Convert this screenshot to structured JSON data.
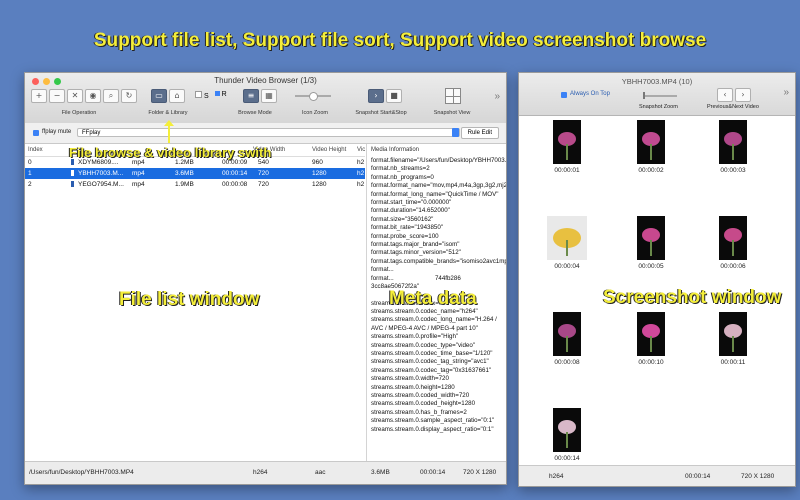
{
  "headline": "Support file list, Support file sort, Support video screenshot browse",
  "main_window": {
    "title": "Thunder Video Browser  (1/3)",
    "toolbar": {
      "file_operation_label": "File Operation",
      "folder_library_label": "Folder & Library",
      "browse_mode_label": "Browse Mode",
      "icon_zoom_label": "Icon Zoom",
      "snapshot_startstop_label": "Snapshot  Start&Stop",
      "snapshot_view_label": "Snapshot View",
      "s_toggle": "S",
      "r_toggle": "R"
    },
    "filter": {
      "checkbox_label": "ffplay mute",
      "player_value": "FFplay",
      "rule_edit_label": "Rule Edit"
    },
    "table": {
      "headers": [
        "Index",
        "",
        "",
        "",
        "Video Width",
        "Video Height",
        "Vic"
      ],
      "rows": [
        {
          "index": "0",
          "name": "XDYM6809....",
          "type": "mp4",
          "size": "1.2MB",
          "duration": "00:00:09",
          "width": "540",
          "height": "960",
          "codec": "h2"
        },
        {
          "index": "1",
          "name": "YBHH7003.M...",
          "type": "mp4",
          "size": "3.6MB",
          "duration": "00:00:14",
          "width": "720",
          "height": "1280",
          "codec": "h2"
        },
        {
          "index": "2",
          "name": "YEGO7954.M...",
          "type": "mp4",
          "size": "1.9MB",
          "duration": "00:00:08",
          "width": "720",
          "height": "1280",
          "codec": "h2"
        }
      ]
    },
    "meta": {
      "header": "Media Information",
      "lines": [
        "format.filename=\"/Users/fun/Desktop/YBHH7003.MP4\"",
        "format.nb_streams=2",
        "format.nb_programs=0",
        "format.format_name=\"mov,mp4,m4a,3gp,3g2,mj2\"",
        "format.format_long_name=\"QuickTime / MOV\"",
        "format.start_time=\"0.000000\"",
        "format.duration=\"14.652000\"",
        "format.size=\"3560162\"",
        "format.bit_rate=\"1943850\"",
        "format.probe_score=100",
        "format.tags.major_brand=\"isom\"",
        "format.tags.minor_version=\"512\"",
        "format.tags.compatible_brands=\"isomiso2avc1mp41\"",
        "format...",
        "format...                        744fb286",
        "3cc8ae50672f2a\"",
        "",
        "streams.stream.0.index=0",
        "streams.stream.0.codec_name=\"h264\"",
        "streams.stream.0.codec_long_name=\"H.264 / AVC / MPEG-4 AVC / MPEG-4 part 10\"",
        "streams.stream.0.profile=\"High\"",
        "streams.stream.0.codec_type=\"video\"",
        "streams.stream.0.codec_time_base=\"1/120\"",
        "streams.stream.0.codec_tag_string=\"avc1\"",
        "streams.stream.0.codec_tag=\"0x31637661\"",
        "streams.stream.0.width=720",
        "streams.stream.0.height=1280",
        "streams.stream.0.coded_width=720",
        "streams.stream.0.coded_height=1280",
        "streams.stream.0.has_b_frames=2",
        "streams.stream.0.sample_aspect_ratio=\"0:1\"",
        "streams.stream.0.display_aspect_ratio=\"0:1\""
      ]
    },
    "status": {
      "path": "/Users/fun/Desktop/YBHH7003.MP4",
      "video_codec": "h264",
      "audio_codec": "aac",
      "size": "3.6MB",
      "duration": "00:00:14",
      "resolution": "720 X 1280"
    }
  },
  "overlays": {
    "file_browse": "File browse & video library swith",
    "file_list": "File list window",
    "meta_data": "Meta data",
    "screenshot": "Screenshot window"
  },
  "snapshot_window": {
    "title": "YBHH7003.MP4   (10)",
    "always_on_top": "Always On Top",
    "snapshot_zoom_label": "Snapshot Zoom",
    "prev_next_label": "Previous&Next Video",
    "thumbnails": [
      {
        "time": "00:00:01",
        "color": "#b84a8a"
      },
      {
        "time": "00:00:02",
        "color": "#c04a90"
      },
      {
        "time": "00:00:03",
        "color": "#b0488a"
      },
      {
        "time": "00:00:04",
        "color": "#e8c040"
      },
      {
        "time": "00:00:05",
        "color": "#c8488e"
      },
      {
        "time": "00:00:06",
        "color": "#c64a8a"
      },
      {
        "time": "00:00:08",
        "color": "#a84888"
      },
      {
        "time": "00:00:10",
        "color": "#d0489a"
      },
      {
        "time": "00:00:11",
        "color": "#d6b0c0"
      },
      {
        "time": "00:00:14",
        "color": "#d8b8c8"
      }
    ],
    "status": {
      "video_codec": "h264",
      "duration": "00:00:14",
      "resolution": "720 X 1280"
    }
  }
}
